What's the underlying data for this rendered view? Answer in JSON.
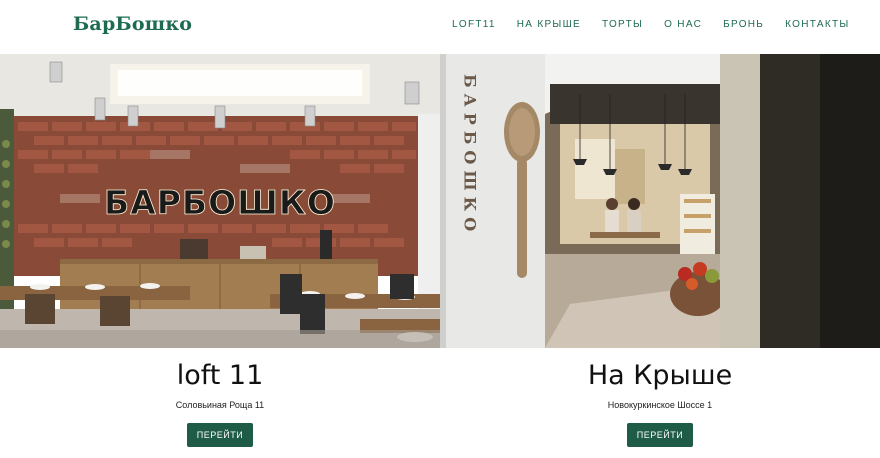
{
  "header": {
    "logo": "БарБошко",
    "nav": [
      "LOFT11",
      "НА КРЫШЕ",
      "ТОРТЫ",
      "О НАС",
      "БРОНЬ",
      "КОНТАКТЫ"
    ]
  },
  "photos": {
    "left_sign": "БАРБОШКО",
    "right_sign": "БАРБОШКО"
  },
  "cards": [
    {
      "title": "loft 11",
      "address": "Соловьиная Роща 11",
      "button": "ПЕРЕЙТИ"
    },
    {
      "title": "На Крыше",
      "address": "Новокуркинское Шоссе 1",
      "button": "ПЕРЕЙТИ"
    }
  ],
  "colors": {
    "brand": "#1f6b52",
    "button": "#1f5c47"
  }
}
